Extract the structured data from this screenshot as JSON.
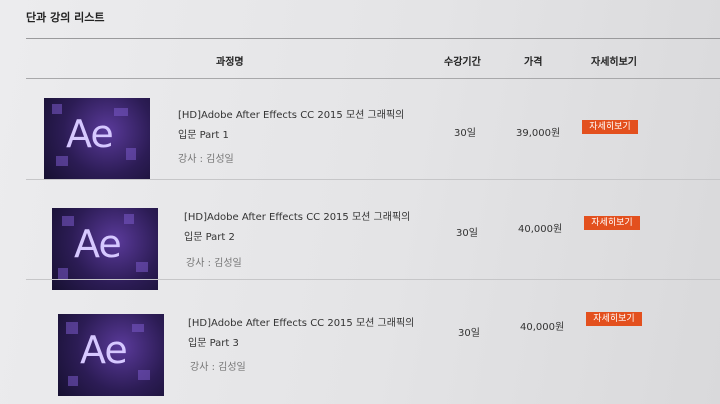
{
  "section": {
    "title": "단과 강의 리스트"
  },
  "table": {
    "headers": {
      "name": "과정명",
      "period": "수강기간",
      "price": "가격",
      "detail": "자세히보기"
    },
    "rows": [
      {
        "title_line1": "[HD]Adobe After Effects CC 2015 모션 그래픽의",
        "title_line2": "입문 Part 1",
        "instructor": "강사 : 김성일",
        "period": "30일",
        "price": "39,000원",
        "detail_label": "자세히보기",
        "thumb_text": "Ae"
      },
      {
        "title_line1": "[HD]Adobe After Effects CC 2015 모션 그래픽의",
        "title_line2": "입문 Part 2",
        "instructor": "강사 : 김성일",
        "period": "30일",
        "price": "40,000원",
        "detail_label": "자세히보기",
        "thumb_text": "Ae"
      },
      {
        "title_line1": "[HD]Adobe After Effects CC 2015 모션 그래픽의",
        "title_line2": "입문 Part 3",
        "instructor": "강사 : 김성일",
        "period": "30일",
        "price": "40,000원",
        "detail_label": "자세히보기",
        "thumb_text": "Ae"
      }
    ]
  },
  "colors": {
    "detail_button": "#e3501e",
    "thumbnail_bg": "#2c1c55"
  },
  "icons": {
    "thumbnail": "after-effects-logo-icon"
  }
}
